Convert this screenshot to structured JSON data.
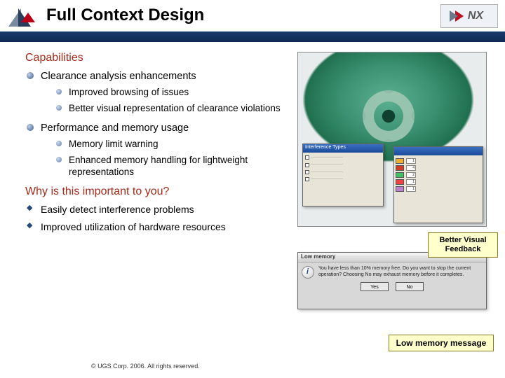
{
  "header": {
    "title": "Full Context Design",
    "badge": "NX"
  },
  "capabilities": {
    "heading": "Capabilities",
    "items": [
      {
        "label": "Clearance analysis enhancements",
        "sub": [
          "Improved browsing of issues",
          "Better visual representation of clearance violations"
        ]
      },
      {
        "label": "Performance and memory usage",
        "sub": [
          "Memory limit warning",
          "Enhanced memory handling for lightweight representations"
        ]
      }
    ]
  },
  "why": {
    "heading": "Why is this important to you?",
    "items": [
      "Easily detect interference problems",
      "Improved utilization of hardware resources"
    ]
  },
  "callouts": {
    "visual_feedback": "Better Visual Feedback",
    "low_memory": "Low memory message"
  },
  "dialogs": {
    "win1_title": "Interference Types",
    "win2_title": " ",
    "lowmem": {
      "title": "Low memory",
      "body": "You have less than 10% memory free. Do you want to stop the current operation? Choosing No may exhaust memory before it completes.",
      "yes": "Yes",
      "no": "No"
    },
    "swatches": {
      "rows": [
        {
          "color": "#f0b030",
          "n": "1"
        },
        {
          "color": "#d04020",
          "n": "4"
        },
        {
          "color": "#40c060",
          "n": "2"
        },
        {
          "color": "#f04040",
          "n": "1"
        },
        {
          "color": "#c080d0",
          "n": "1"
        }
      ]
    }
  },
  "footer": "© UGS Corp. 2006. All rights reserved."
}
